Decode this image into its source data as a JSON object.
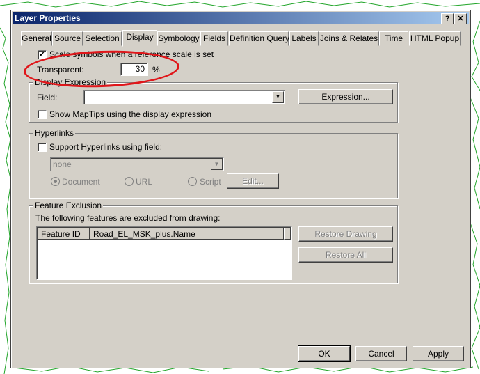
{
  "window": {
    "title": "Layer Properties",
    "help_btn": "?",
    "close_btn": "✕"
  },
  "tabs": [
    "General",
    "Source",
    "Selection",
    "Display",
    "Symbology",
    "Fields",
    "Definition Query",
    "Labels",
    "Joins & Relates",
    "Time",
    "HTML Popup"
  ],
  "active_tab": "Display",
  "display": {
    "scale_symbols_label": "Scale symbols when a reference scale is set",
    "scale_symbols_checked": true,
    "transparent_label": "Transparent:",
    "transparent_value": "30",
    "transparent_unit": "%"
  },
  "display_expression": {
    "group_title": "Display Expression",
    "field_label": "Field:",
    "field_value": "",
    "expression_button": "Expression...",
    "maptips_label": "Show MapTips using the display expression",
    "maptips_checked": false
  },
  "hyperlinks": {
    "group_title": "Hyperlinks",
    "support_label": "Support Hyperlinks using field:",
    "support_checked": false,
    "field_value": "none",
    "radio_document": "Document",
    "radio_url": "URL",
    "radio_script": "Script",
    "edit_button": "Edit..."
  },
  "feature_exclusion": {
    "group_title": "Feature Exclusion",
    "description": "The following features are excluded from drawing:",
    "columns": [
      "Feature ID",
      "Road_EL_MSK_plus.Name"
    ],
    "restore_drawing_button": "Restore Drawing",
    "restore_all_button": "Restore All"
  },
  "footer": {
    "ok": "OK",
    "cancel": "Cancel",
    "apply": "Apply"
  },
  "colors": {
    "annotation": "#e0161a",
    "title_bar": "#0a246a",
    "dialog_bg": "#d4d0c8",
    "map_lines": "#22a52a"
  }
}
